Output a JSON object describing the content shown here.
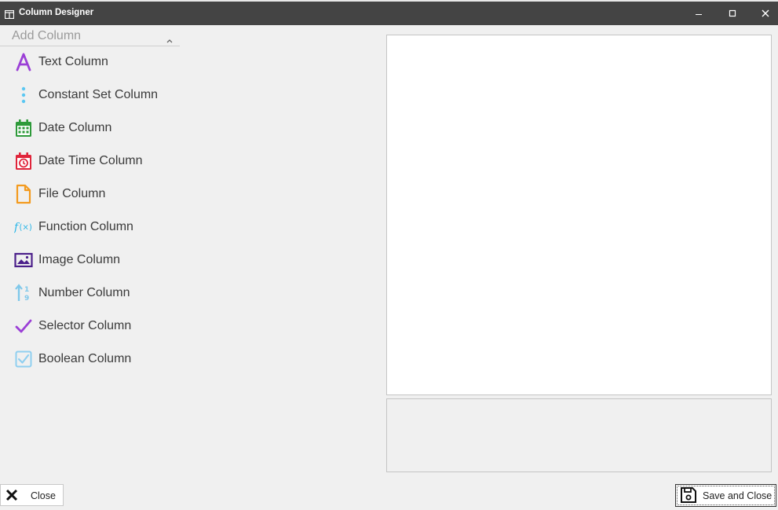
{
  "window": {
    "title": "Column Designer",
    "icon": "table-icon",
    "controls": [
      "minimize-icon",
      "maximize-icon",
      "close-icon"
    ]
  },
  "sidebar": {
    "header": "Add Column",
    "collapse_icon": "chevron-up-icon",
    "items": [
      {
        "label": "Text Column",
        "icon": "text-a-icon",
        "color": "#9b3fd6"
      },
      {
        "label": "Constant Set Column",
        "icon": "vertical-dots-icon",
        "color": "#5bc7f2"
      },
      {
        "label": "Date Column",
        "icon": "calendar-icon",
        "color": "#2e9a3a"
      },
      {
        "label": "Date Time Column",
        "icon": "calendar-clock-icon",
        "color": "#e0243a"
      },
      {
        "label": "File Column",
        "icon": "file-icon",
        "color": "#f39a1e"
      },
      {
        "label": "Function Column",
        "icon": "function-icon",
        "color": "#29b6e8"
      },
      {
        "label": "Image Column",
        "icon": "image-icon",
        "color": "#4b1f8a"
      },
      {
        "label": "Number Column",
        "icon": "number-sort-icon",
        "color": "#7fc8ea"
      },
      {
        "label": "Selector Column",
        "icon": "checkmark-icon",
        "color": "#9b3fd6"
      },
      {
        "label": "Boolean Column",
        "icon": "checkbox-icon",
        "color": "#8fcff0"
      }
    ]
  },
  "footer": {
    "close_label": "Close",
    "save_label": "Save and Close"
  }
}
